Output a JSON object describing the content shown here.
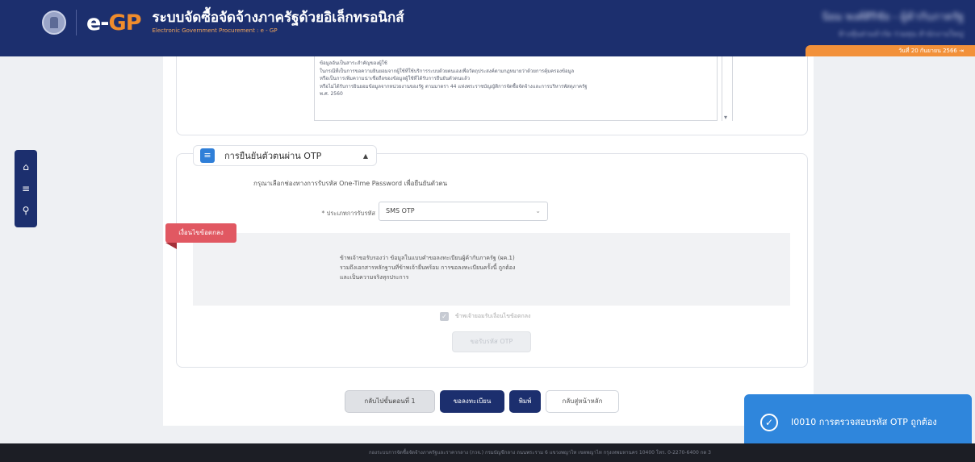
{
  "header": {
    "logo_e": "e-",
    "logo_gp": "GP",
    "title": "ระบบจัดซื้อจัดจ้างภาครัฐด้วยอิเล็กทรอนิกส์",
    "subtitle": "Electronic Government Procurement : e - GP",
    "user_name": "นิยม พงศ์ศิริชัย - ผู้ค้ากับภาครัฐ",
    "user_org": "ห้างหุ้นส่วนจำกัด ร่วมทุน สำนักงานใหญ่",
    "date_text": "วันที่ 20 กันยายน 2566"
  },
  "side_menu": [
    "home-icon",
    "menu-icon",
    "search-icon"
  ],
  "terms": {
    "lines": [
      "ข้อมูลอันเป็นสาระสำคัญของผู้ใช้",
      "ในกรณีที่เป็นการขอความยินยอมจากผู้ใช้ที่ใช้บริการระบบด้วยตนเองเพื่อวัตถุประสงค์ตามกฎหมายว่าด้วยการคุ้มครองข้อมูล",
      "หรือเป็นการเพิ่มความน่าเชื่อถือของข้อมูลผู้ใช้ที่ได้รับการยืนยันตัวตนแล้ว",
      "หรือไม่ได้รับการยินยอมข้อมูลจากหน่วยงานของรัฐ ตามมาตรา 44 แห่งพระราชบัญญัติการจัดซื้อจัดจ้างและการบริหารพัสดุภาครัฐ",
      "พ.ศ. 2560"
    ]
  },
  "otp_section": {
    "title": "การยืนยันตัวตนผ่าน OTP",
    "toggle": "▲",
    "instruction": "กรุณาเลือกช่องทางการรับรหัส One-Time Password เพื่อยืนยันตัวตน",
    "method_label": "* ประเภทการรับรหัส",
    "method_value": "SMS OTP",
    "ribbon": "เงื่อนไขข้อตกลง",
    "agreement": [
      "ข้าพเจ้าขอรับรองว่า ข้อมูลในแบบคำขอลงทะเบียนผู้ค้ากับภาครัฐ (ผค.1)",
      "รวมถึงเอกสารหลักฐานที่ข้าพเจ้ายื่นพร้อม การขอลงทะเบียนครั้งนี้ ถูกต้อง",
      "และเป็นความจริงทุกประการ"
    ],
    "checkbox_label": "ข้าพเจ้ายอมรับเงื่อนไขข้อตกลง",
    "send_button": "ขอรับรหัส OTP"
  },
  "actions": {
    "back_step": "กลับไปขั้นตอนที่ 1",
    "submit": "ขอลงทะเบียน",
    "print": "พิมพ์",
    "home": "กลับสู่หน้าหลัก"
  },
  "toast": {
    "message": "I0010 การตรวจสอบรหัส OTP ถูกต้อง"
  },
  "footer": {
    "text": "กองระบบการจัดซื้อจัดจ้างภาครัฐและราคากลาง (กวจ.) กรมบัญชีกลาง ถนนพระราม 6 แขวงพญาไท เขตพญาไท กรุงเทพมหานคร 10400 โทร. 0-2270-6400 กด 3"
  }
}
